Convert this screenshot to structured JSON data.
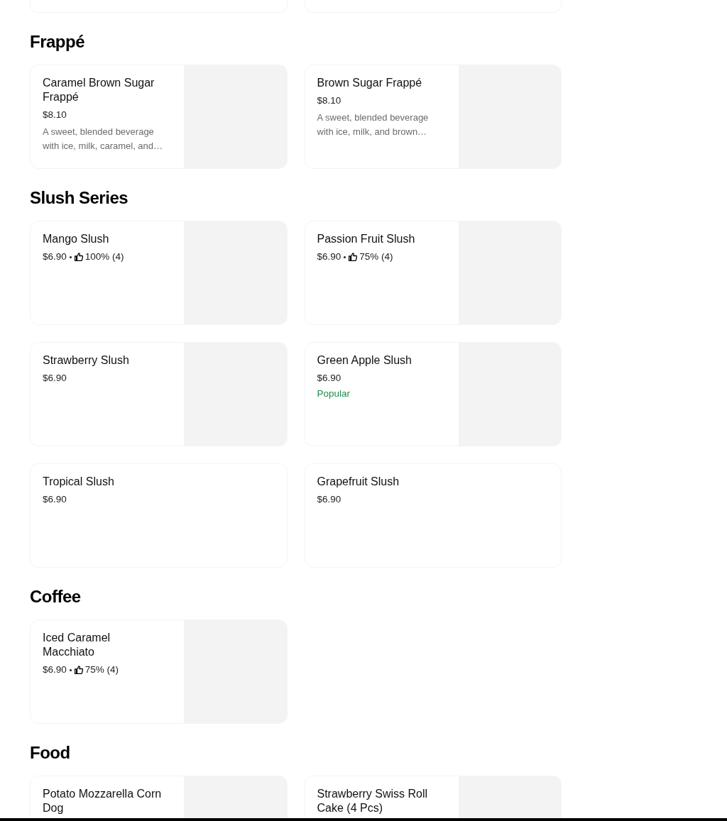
{
  "sections": [
    {
      "title": "Frappé",
      "items": [
        {
          "name": "Caramel Brown Sugar Frappé",
          "price": "$8.10",
          "description": "A sweet, blended beverage with ice, milk, caramel, and…",
          "has_image": true
        },
        {
          "name": "Brown Sugar Frappé",
          "price": "$8.10",
          "description": "A sweet, blended beverage with ice, milk, and brown…",
          "has_image": true
        }
      ]
    },
    {
      "title": "Slush Series",
      "items": [
        {
          "name": "Mango Slush",
          "price": "$6.90",
          "rating": "100% (4)",
          "has_image": true
        },
        {
          "name": "Passion Fruit Slush",
          "price": "$6.90",
          "rating": "75% (4)",
          "has_image": true
        },
        {
          "name": "Strawberry Slush",
          "price": "$6.90",
          "has_image": true
        },
        {
          "name": "Green Apple Slush",
          "price": "$6.90",
          "badge": "Popular",
          "has_image": true
        },
        {
          "name": "Tropical Slush",
          "price": "$6.90",
          "has_image": false
        },
        {
          "name": "Grapefruit Slush",
          "price": "$6.90",
          "has_image": false
        }
      ]
    },
    {
      "title": "Coffee",
      "items": [
        {
          "name": "Iced Caramel Macchiato",
          "price": "$6.90",
          "rating": "75% (4)",
          "has_image": true
        }
      ]
    },
    {
      "title": "Food",
      "items": [
        {
          "name": "Potato Mozzarella Corn Dog",
          "has_image": true
        },
        {
          "name": "Strawberry Swiss Roll Cake (4 Pcs)",
          "has_image": true
        }
      ]
    }
  ]
}
